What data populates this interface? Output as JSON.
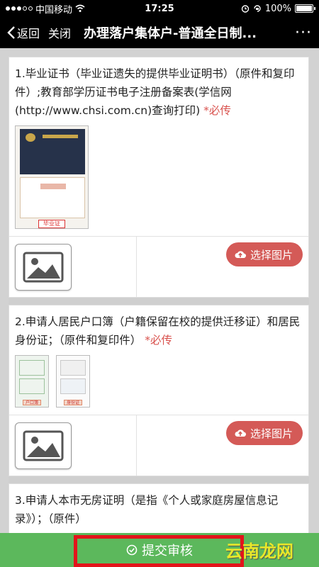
{
  "status": {
    "carrier": "中国移动",
    "time": "17:25",
    "battery": "100%",
    "battery_level": 1.0
  },
  "nav": {
    "back_label": "返回",
    "close_label": "关闭",
    "title": "办理落户集体户-普通全日制...",
    "more_icon": "more-icon"
  },
  "items": [
    {
      "text": "1.毕业证书（毕业证遗失的提供毕业证明书）（原件和复印件）;教育部学历证书电子注册备案表(学信网(http://www.chsi.com.cn)查询打印)",
      "required": "*必传",
      "thumb_tags": [
        "毕业证"
      ],
      "pick_label": "选择图片"
    },
    {
      "text": "2.申请人居民户口簿（户籍保留在校的提供迁移证）和居民身份证；（原件和复印件）",
      "required": "*必传",
      "thumb_tags": [
        "户口簿",
        "身份证"
      ],
      "pick_label": "选择图片"
    },
    {
      "text": "3.申请人本市无房证明（是指《个人或家庭房屋信息记录》）；（原件）"
    }
  ],
  "submit": {
    "label": "提交审核"
  },
  "watermark": "云南龙网",
  "colors": {
    "accent_red": "#d45a57",
    "required_red": "#d9534f",
    "submit_green": "#5cb85c",
    "highlight_red": "#e3141b"
  }
}
